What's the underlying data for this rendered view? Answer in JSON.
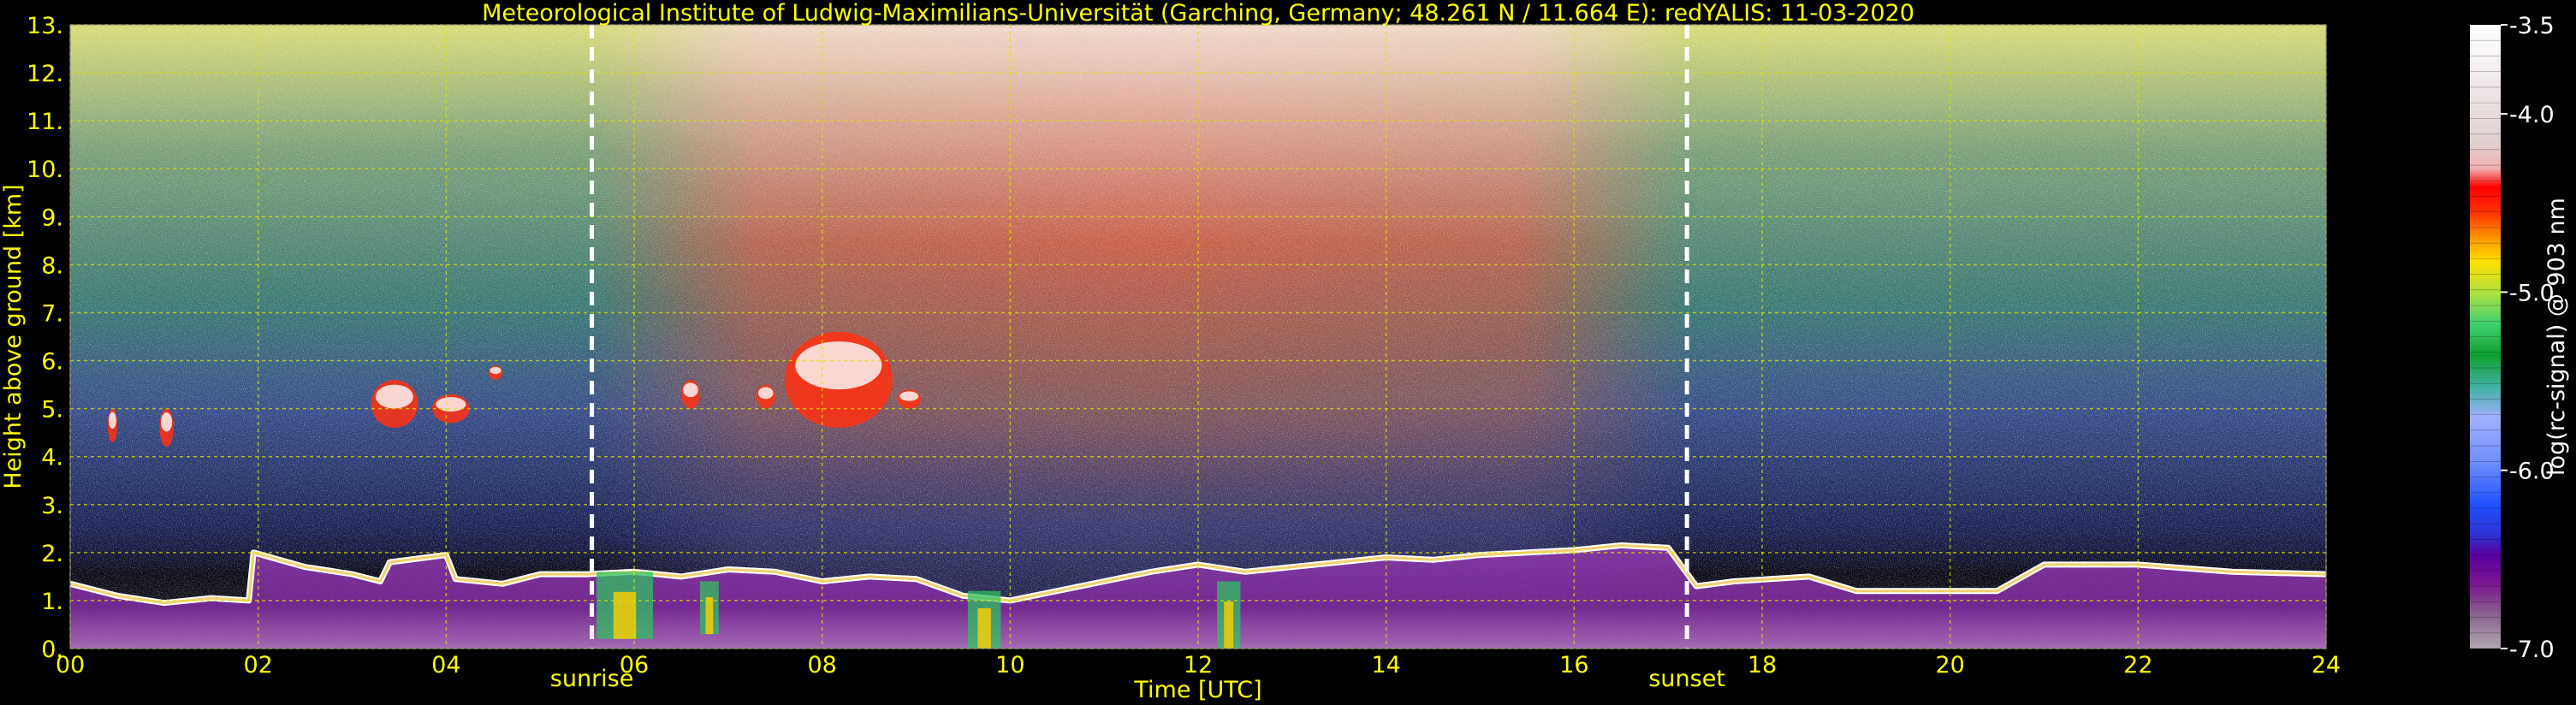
{
  "chart_data": {
    "type": "heatmap",
    "title": "Meteorological Institute of Ludwig-Maximilians-Universität (Garching, Germany; 48.261 N / 11.664 E):    redYALIS: 11-03-2020",
    "xlabel": "Time [UTC]",
    "ylabel": "Height above ground [km]",
    "xlim": [
      0,
      24
    ],
    "ylim": [
      0,
      13
    ],
    "x_ticks": [
      0,
      2,
      4,
      6,
      8,
      10,
      12,
      14,
      16,
      18,
      20,
      22,
      24
    ],
    "x_tick_labels": [
      "00",
      "02",
      "04",
      "06",
      "08",
      "10",
      "12",
      "14",
      "16",
      "18",
      "20",
      "22",
      "24"
    ],
    "y_ticks": [
      0,
      1,
      2,
      3,
      4,
      5,
      6,
      7,
      8,
      9,
      10,
      11,
      12,
      13
    ],
    "y_tick_labels": [
      "0.",
      "1.",
      "2.",
      "3.",
      "4.",
      "5.",
      "6.",
      "7.",
      "8.",
      "9.",
      "10.",
      "11.",
      "12.",
      "13."
    ],
    "grid": true,
    "annotations": [
      {
        "text": "sunrise",
        "x": 5.55
      },
      {
        "text": "sunset",
        "x": 17.2
      }
    ],
    "colorbar": {
      "label": "log(rc-signal) @ 903 nm",
      "range": [
        -7.0,
        -3.5
      ],
      "tick_values": [
        -3.5,
        -4.0,
        -5.0,
        -6.0,
        -7.0
      ],
      "tick_labels": [
        "-3.5",
        "-4.0",
        "-5.0",
        "-6.0",
        "-7.0"
      ]
    },
    "features": {
      "boundary_layer_top_km": [
        [
          0.0,
          1.35
        ],
        [
          0.5,
          1.1
        ],
        [
          1.0,
          0.95
        ],
        [
          1.5,
          1.05
        ],
        [
          1.9,
          1.0
        ],
        [
          1.95,
          2.0
        ],
        [
          2.5,
          1.7
        ],
        [
          3.0,
          1.55
        ],
        [
          3.3,
          1.4
        ],
        [
          3.4,
          1.8
        ],
        [
          4.0,
          1.95
        ],
        [
          4.1,
          1.45
        ],
        [
          4.6,
          1.35
        ],
        [
          5.0,
          1.55
        ],
        [
          5.5,
          1.55
        ],
        [
          6.0,
          1.6
        ],
        [
          6.5,
          1.5
        ],
        [
          7.0,
          1.65
        ],
        [
          7.5,
          1.6
        ],
        [
          8.0,
          1.4
        ],
        [
          8.5,
          1.5
        ],
        [
          9.0,
          1.45
        ],
        [
          9.5,
          1.1
        ],
        [
          10.0,
          1.0
        ],
        [
          10.5,
          1.2
        ],
        [
          11.0,
          1.4
        ],
        [
          11.5,
          1.6
        ],
        [
          12.0,
          1.75
        ],
        [
          12.5,
          1.6
        ],
        [
          13.0,
          1.7
        ],
        [
          13.5,
          1.8
        ],
        [
          14.0,
          1.9
        ],
        [
          14.5,
          1.85
        ],
        [
          15.0,
          1.95
        ],
        [
          15.5,
          2.0
        ],
        [
          16.0,
          2.05
        ],
        [
          16.5,
          2.15
        ],
        [
          17.0,
          2.1
        ],
        [
          17.3,
          1.3
        ],
        [
          17.7,
          1.4
        ],
        [
          18.5,
          1.5
        ],
        [
          19.0,
          1.2
        ],
        [
          20.5,
          1.2
        ],
        [
          21.0,
          1.75
        ],
        [
          22.0,
          1.75
        ],
        [
          23.0,
          1.6
        ],
        [
          24.0,
          1.55
        ]
      ],
      "cloud_patches": [
        {
          "x": [
            0.4,
            0.5
          ],
          "y": [
            4.3,
            5.0
          ]
        },
        {
          "x": [
            0.95,
            1.1
          ],
          "y": [
            4.2,
            5.0
          ]
        },
        {
          "x": [
            3.2,
            3.7
          ],
          "y": [
            4.6,
            5.6
          ]
        },
        {
          "x": [
            3.85,
            4.25
          ],
          "y": [
            4.7,
            5.3
          ]
        },
        {
          "x": [
            4.45,
            4.6
          ],
          "y": [
            5.6,
            5.9
          ]
        },
        {
          "x": [
            6.5,
            6.7
          ],
          "y": [
            5.0,
            5.6
          ]
        },
        {
          "x": [
            7.3,
            7.5
          ],
          "y": [
            5.0,
            5.5
          ]
        },
        {
          "x": [
            7.6,
            8.75
          ],
          "y": [
            4.6,
            6.6
          ]
        },
        {
          "x": [
            8.8,
            9.05
          ],
          "y": [
            5.0,
            5.4
          ]
        }
      ],
      "rain_streaks": [
        {
          "x": [
            5.6,
            6.2
          ],
          "y": [
            0.2,
            1.6
          ]
        },
        {
          "x": [
            6.7,
            6.9
          ],
          "y": [
            0.3,
            1.4
          ]
        },
        {
          "x": [
            9.55,
            9.9
          ],
          "y": [
            0.0,
            1.2
          ]
        },
        {
          "x": [
            12.2,
            12.45
          ],
          "y": [
            0.0,
            1.4
          ]
        }
      ]
    }
  }
}
